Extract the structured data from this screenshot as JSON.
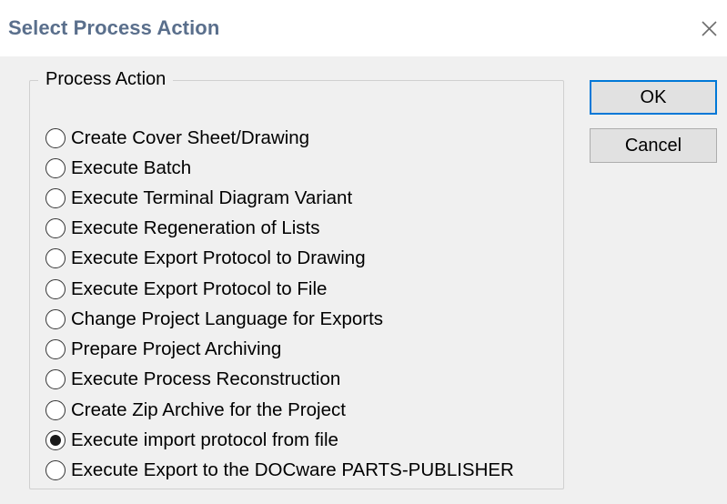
{
  "dialog": {
    "title": "Select Process Action",
    "close_icon": "close-icon"
  },
  "group": {
    "label": "Process Action"
  },
  "buttons": {
    "ok": "OK",
    "cancel": "Cancel"
  },
  "options": [
    {
      "label": "Create Cover Sheet/Drawing",
      "checked": false
    },
    {
      "label": "Execute Batch",
      "checked": false
    },
    {
      "label": "Execute Terminal Diagram Variant",
      "checked": false
    },
    {
      "label": "Execute Regeneration of Lists",
      "checked": false
    },
    {
      "label": "Execute Export Protocol to Drawing",
      "checked": false
    },
    {
      "label": "Execute Export Protocol to File",
      "checked": false
    },
    {
      "label": "Change Project Language for Exports",
      "checked": false
    },
    {
      "label": "Prepare Project Archiving",
      "checked": false
    },
    {
      "label": "Execute Process Reconstruction",
      "checked": false
    },
    {
      "label": "Create Zip Archive for the Project",
      "checked": false
    },
    {
      "label": "Execute import protocol from file",
      "checked": true
    },
    {
      "label": "Execute Export to the DOCware PARTS-PUBLISHER",
      "checked": false
    }
  ],
  "colors": {
    "title_text": "#5a6f8c",
    "default_button_border": "#0078d7",
    "dialog_background": "#f0f0f0"
  }
}
